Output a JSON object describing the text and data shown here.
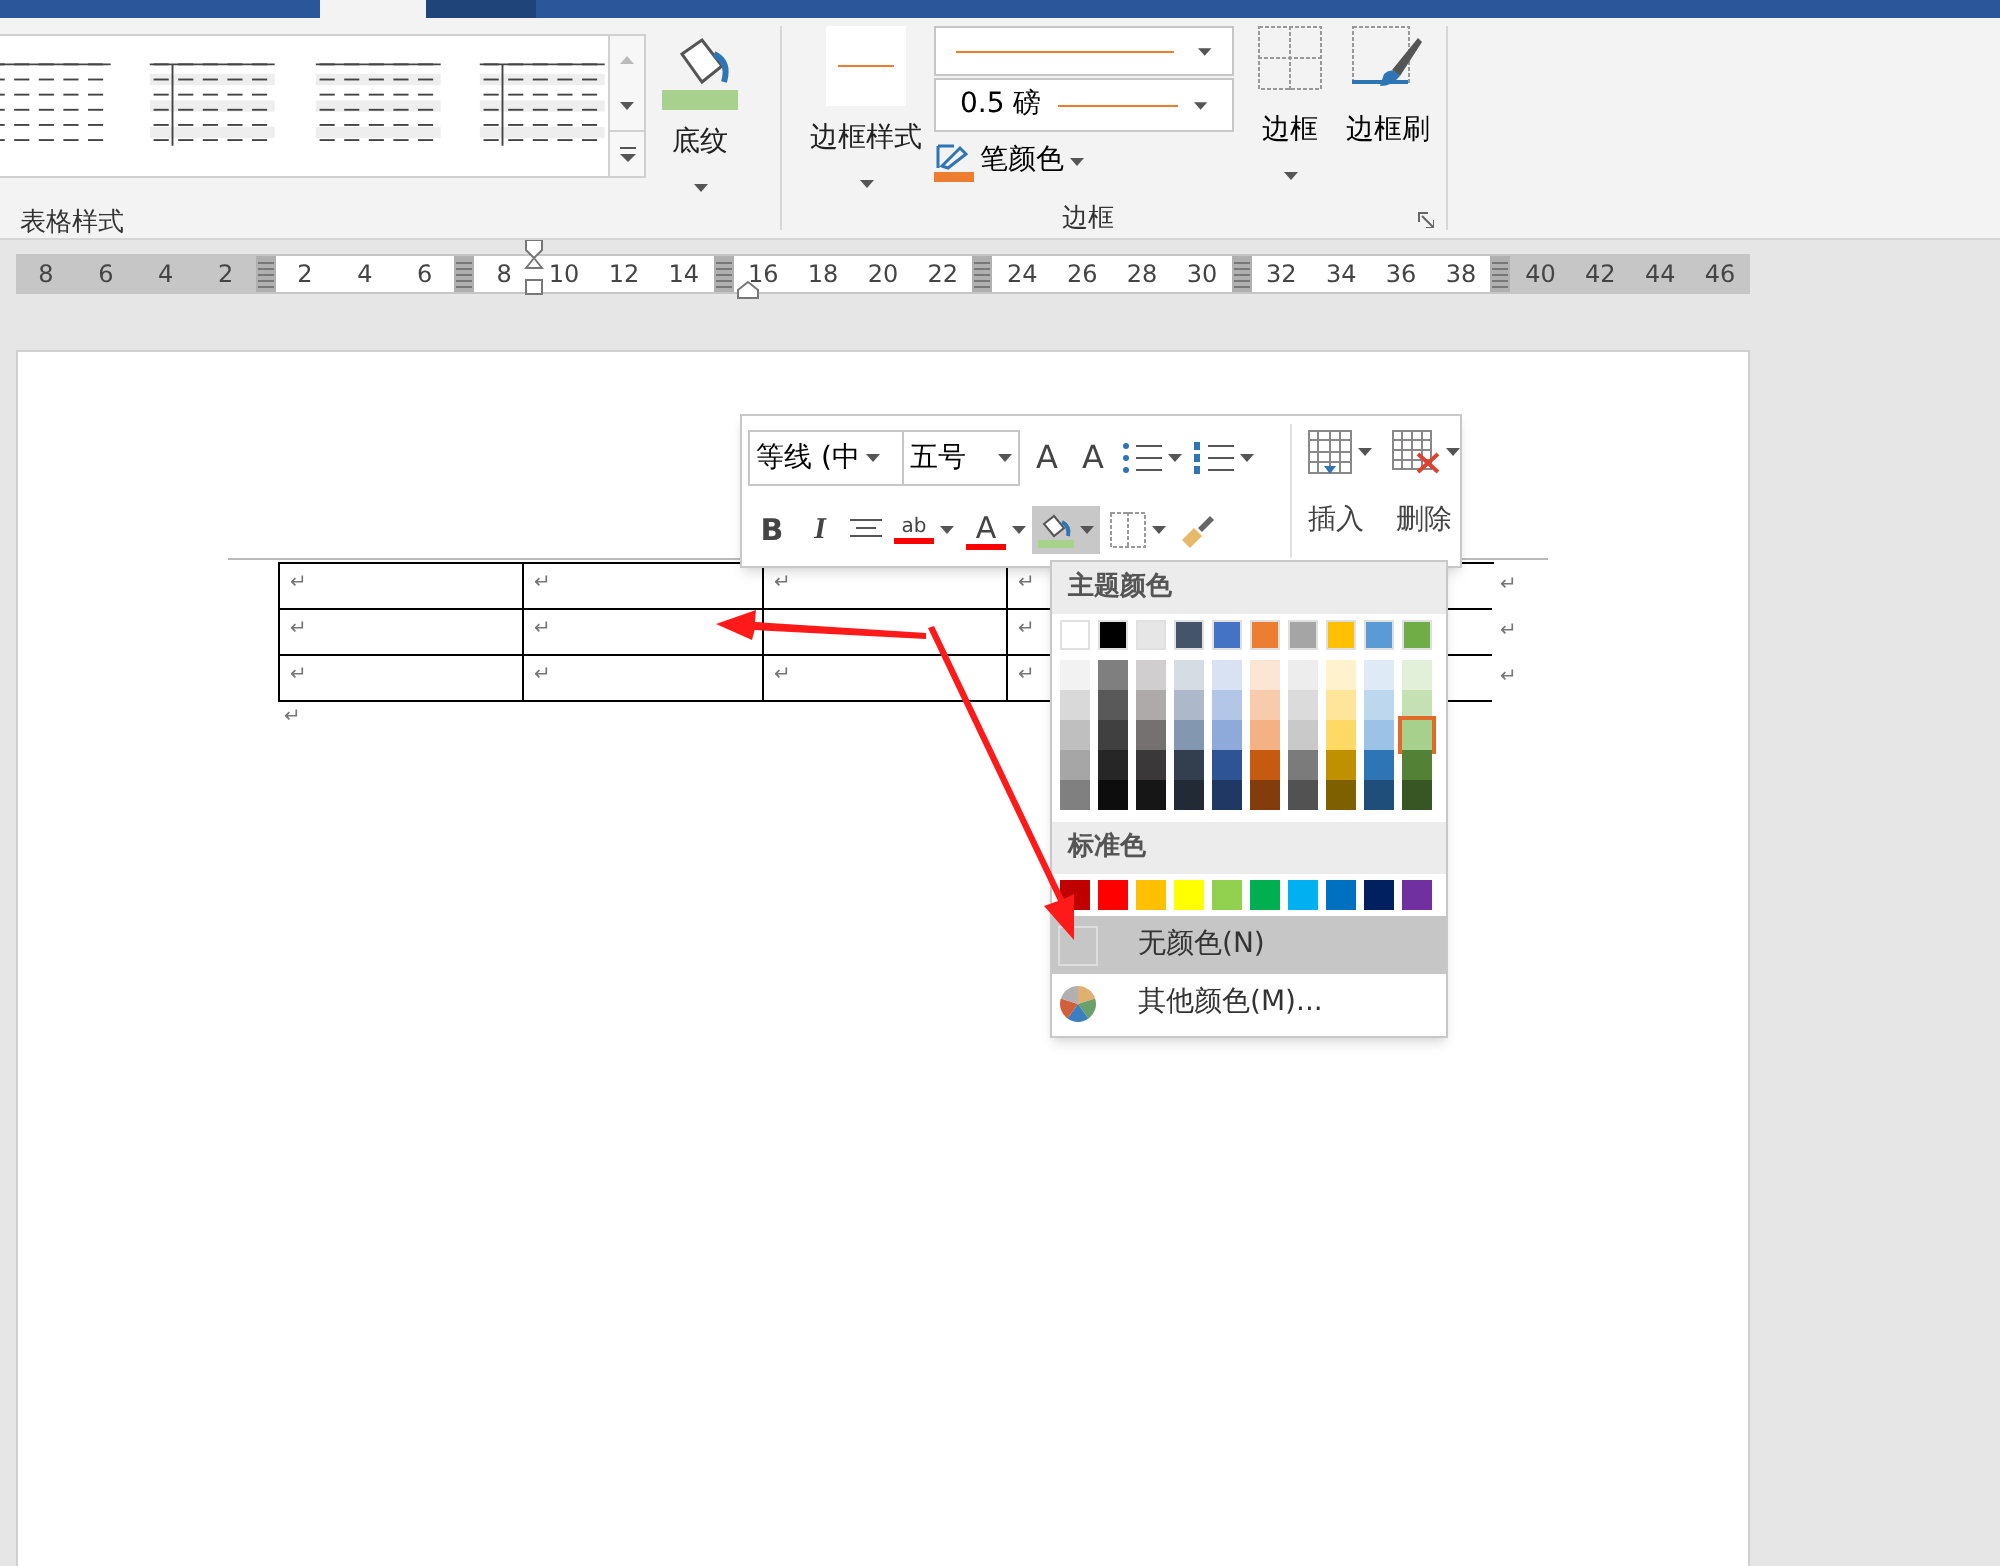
{
  "ribbon": {
    "table_styles": {
      "label": "表格样式",
      "shading_button": {
        "label": "底纹"
      }
    },
    "borders": {
      "label": "边框",
      "border_styles_button": {
        "label": "边框样式"
      },
      "line_weight": {
        "value": "0.5 磅"
      },
      "pen_color": {
        "label": "笔颜色"
      },
      "borders_button": {
        "label": "边框"
      },
      "border_painter": {
        "label": "边框刷"
      }
    }
  },
  "ruler": [
    {
      "kind": "number",
      "label": "8",
      "shaded": true
    },
    {
      "kind": "number",
      "label": "6",
      "shaded": true
    },
    {
      "kind": "number",
      "label": "4",
      "shaded": true
    },
    {
      "kind": "number",
      "label": "2",
      "shaded": true
    },
    {
      "kind": "marker",
      "shaded": true
    },
    {
      "kind": "number",
      "label": "2",
      "shaded": false
    },
    {
      "kind": "number",
      "label": "4",
      "shaded": false
    },
    {
      "kind": "number",
      "label": "6",
      "shaded": false
    },
    {
      "kind": "marker",
      "shaded": true
    },
    {
      "kind": "number",
      "label": "8",
      "shaded": false
    },
    {
      "kind": "number",
      "label": "10",
      "shaded": false
    },
    {
      "kind": "number",
      "label": "12",
      "shaded": false
    },
    {
      "kind": "number",
      "label": "14",
      "shaded": false
    },
    {
      "kind": "marker",
      "shaded": true
    },
    {
      "kind": "number",
      "label": "16",
      "shaded": false
    },
    {
      "kind": "number",
      "label": "18",
      "shaded": false
    },
    {
      "kind": "number",
      "label": "20",
      "shaded": false
    },
    {
      "kind": "number",
      "label": "22",
      "shaded": false
    },
    {
      "kind": "marker",
      "shaded": true
    },
    {
      "kind": "number",
      "label": "24",
      "shaded": false
    },
    {
      "kind": "number",
      "label": "26",
      "shaded": false
    },
    {
      "kind": "number",
      "label": "28",
      "shaded": false
    },
    {
      "kind": "number",
      "label": "30",
      "shaded": false
    },
    {
      "kind": "marker",
      "shaded": true
    },
    {
      "kind": "number",
      "label": "32",
      "shaded": false
    },
    {
      "kind": "number",
      "label": "34",
      "shaded": false
    },
    {
      "kind": "number",
      "label": "36",
      "shaded": false
    },
    {
      "kind": "number",
      "label": "38",
      "shaded": false
    },
    {
      "kind": "marker",
      "shaded": true
    },
    {
      "kind": "number",
      "label": "40",
      "shaded": true
    },
    {
      "kind": "number",
      "label": "42",
      "shaded": true
    },
    {
      "kind": "number",
      "label": "44",
      "shaded": true
    },
    {
      "kind": "number",
      "label": "46",
      "shaded": true
    }
  ],
  "table": {
    "rows": [
      {
        "cells": [
          {
            "text": "↵"
          },
          {
            "text": "↵"
          },
          {
            "text": "↵"
          },
          {
            "text": "↵"
          }
        ],
        "end_mark": "↵"
      },
      {
        "cells": [
          {
            "text": "↵"
          },
          {
            "text": "↵"
          },
          {},
          {
            "text": "↵"
          }
        ],
        "end_mark": "↵"
      },
      {
        "cells": [
          {
            "text": "↵"
          },
          {
            "text": "↵"
          },
          {
            "text": "↵"
          },
          {
            "text": "↵"
          }
        ],
        "end_mark": "↵"
      }
    ],
    "after_mark": "↵"
  },
  "mini_toolbar": {
    "font": "等线 (中",
    "size": "五号",
    "grow_font": "A",
    "shrink_font": "A",
    "bold": "B",
    "italic": "I",
    "font_color": "A",
    "highlight": "ab",
    "shading_active": true,
    "insert_label": "插入",
    "delete_label": "删除"
  },
  "color_menu": {
    "theme_heading": "主题颜色",
    "theme_colors": [
      {
        "color": "#ffffff",
        "selected": false,
        "shades": [
          {
            "color": "#f2f2f2",
            "selected": false
          },
          {
            "color": "#d9d9d9",
            "selected": false
          },
          {
            "color": "#bfbfbf",
            "selected": false
          },
          {
            "color": "#a6a6a6",
            "selected": false
          },
          {
            "color": "#808080",
            "selected": false
          }
        ]
      },
      {
        "color": "#000000",
        "selected": false,
        "shades": [
          {
            "color": "#7f7f7f",
            "selected": false
          },
          {
            "color": "#595959",
            "selected": false
          },
          {
            "color": "#404040",
            "selected": false
          },
          {
            "color": "#262626",
            "selected": false
          },
          {
            "color": "#0d0d0d",
            "selected": false
          }
        ]
      },
      {
        "color": "#e7e6e6",
        "selected": false,
        "shades": [
          {
            "color": "#d0cece",
            "selected": false
          },
          {
            "color": "#aeaaaa",
            "selected": false
          },
          {
            "color": "#757171",
            "selected": false
          },
          {
            "color": "#3a3838",
            "selected": false
          },
          {
            "color": "#171616",
            "selected": false
          }
        ]
      },
      {
        "color": "#44546a",
        "selected": false,
        "shades": [
          {
            "color": "#d6dce4",
            "selected": false
          },
          {
            "color": "#adb9ca",
            "selected": false
          },
          {
            "color": "#8497b0",
            "selected": false
          },
          {
            "color": "#333f4f",
            "selected": false
          },
          {
            "color": "#222a35",
            "selected": false
          }
        ]
      },
      {
        "color": "#4472c4",
        "selected": false,
        "shades": [
          {
            "color": "#d9e2f3",
            "selected": false
          },
          {
            "color": "#b4c6e7",
            "selected": false
          },
          {
            "color": "#8eaadb",
            "selected": false
          },
          {
            "color": "#2f5496",
            "selected": false
          },
          {
            "color": "#1f3864",
            "selected": false
          }
        ]
      },
      {
        "color": "#ed7d31",
        "selected": false,
        "shades": [
          {
            "color": "#fbe5d5",
            "selected": false
          },
          {
            "color": "#f7cbac",
            "selected": false
          },
          {
            "color": "#f4b183",
            "selected": false
          },
          {
            "color": "#c55a11",
            "selected": false
          },
          {
            "color": "#833c0b",
            "selected": false
          }
        ]
      },
      {
        "color": "#a5a5a5",
        "selected": false,
        "shades": [
          {
            "color": "#ededed",
            "selected": false
          },
          {
            "color": "#dbdbdb",
            "selected": false
          },
          {
            "color": "#c9c9c9",
            "selected": false
          },
          {
            "color": "#7b7b7b",
            "selected": false
          },
          {
            "color": "#525252",
            "selected": false
          }
        ]
      },
      {
        "color": "#ffc000",
        "selected": false,
        "shades": [
          {
            "color": "#fff2cc",
            "selected": false
          },
          {
            "color": "#fee599",
            "selected": false
          },
          {
            "color": "#ffd965",
            "selected": false
          },
          {
            "color": "#bf9000",
            "selected": false
          },
          {
            "color": "#7f6000",
            "selected": false
          }
        ]
      },
      {
        "color": "#5b9bd5",
        "selected": false,
        "shades": [
          {
            "color": "#deebf6",
            "selected": false
          },
          {
            "color": "#bdd7ee",
            "selected": false
          },
          {
            "color": "#9cc3e5",
            "selected": false
          },
          {
            "color": "#2e75b5",
            "selected": false
          },
          {
            "color": "#1e4e79",
            "selected": false
          }
        ]
      },
      {
        "color": "#70ad47",
        "selected": false,
        "shades": [
          {
            "color": "#e2efd9",
            "selected": false
          },
          {
            "color": "#c5e0b3",
            "selected": false
          },
          {
            "color": "#a8d08d",
            "selected": true
          },
          {
            "color": "#538135",
            "selected": false
          },
          {
            "color": "#375623",
            "selected": false
          }
        ]
      }
    ],
    "standard_heading": "标准色",
    "standard_colors": [
      {
        "color": "#c00000",
        "selected": false
      },
      {
        "color": "#ff0000",
        "selected": false
      },
      {
        "color": "#ffc000",
        "selected": false
      },
      {
        "color": "#ffff00",
        "selected": false
      },
      {
        "color": "#92d050",
        "selected": false
      },
      {
        "color": "#00b050",
        "selected": false
      },
      {
        "color": "#00b0f0",
        "selected": false
      },
      {
        "color": "#0070c0",
        "selected": false
      },
      {
        "color": "#002060",
        "selected": false
      },
      {
        "color": "#7030a0",
        "selected": false
      }
    ],
    "items": [
      {
        "kind": "no_color",
        "label": "无颜色(N)",
        "highlighted": true
      },
      {
        "kind": "more_colors",
        "label": "其他颜色(M)...",
        "highlighted": false
      }
    ]
  }
}
